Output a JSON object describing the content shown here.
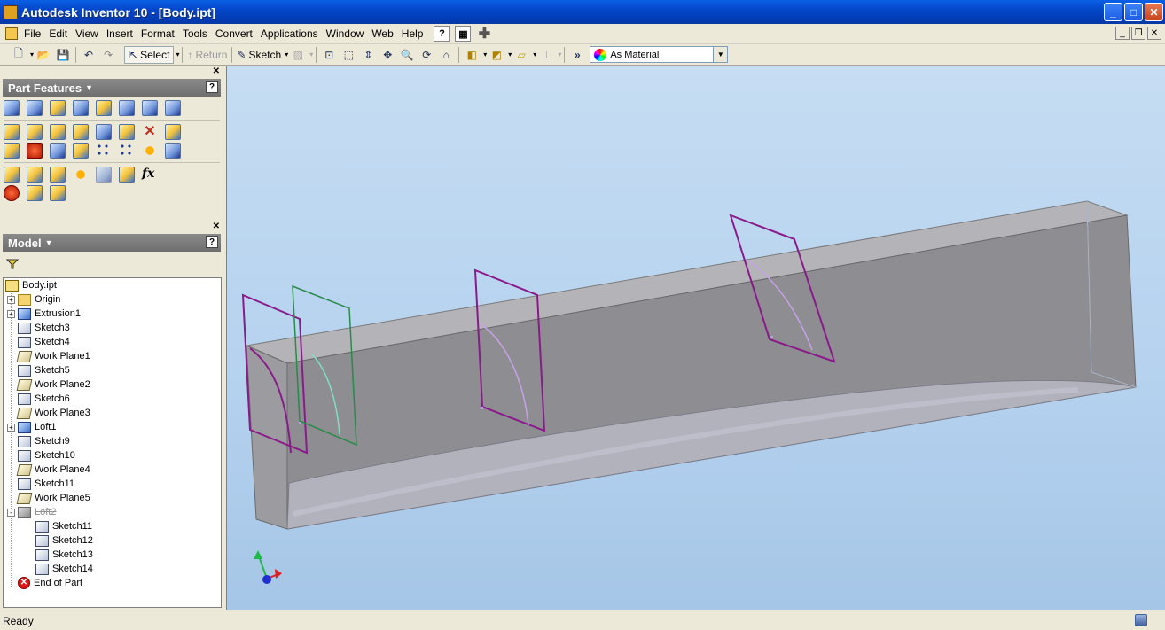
{
  "window": {
    "title": "Autodesk Inventor 10 - [Body.ipt]",
    "controls": [
      "minimize-icon",
      "maximize-icon",
      "close-icon"
    ]
  },
  "menu": {
    "items": [
      "File",
      "Edit",
      "View",
      "Insert",
      "Format",
      "Tools",
      "Convert",
      "Applications",
      "Window",
      "Web",
      "Help"
    ]
  },
  "toolbar": {
    "select_label": "Select",
    "return_label": "Return",
    "sketch_label": "Sketch",
    "color_select": "As Material"
  },
  "part_features": {
    "title": "Part Features",
    "help": "?"
  },
  "model": {
    "title": "Model",
    "help": "?",
    "tree": [
      {
        "label": "Body.ipt",
        "icon": "part-icon",
        "level": 0,
        "expander": ""
      },
      {
        "label": "Origin",
        "icon": "folder-icon",
        "level": 1,
        "expander": "+"
      },
      {
        "label": "Extrusion1",
        "icon": "extrusion-icon",
        "level": 1,
        "expander": "+"
      },
      {
        "label": "Sketch3",
        "icon": "sketch-icon",
        "level": 1,
        "expander": ""
      },
      {
        "label": "Sketch4",
        "icon": "sketch-icon",
        "level": 1,
        "expander": ""
      },
      {
        "label": "Work Plane1",
        "icon": "work-plane-icon",
        "level": 1,
        "expander": ""
      },
      {
        "label": "Sketch5",
        "icon": "sketch-icon",
        "level": 1,
        "expander": ""
      },
      {
        "label": "Work Plane2",
        "icon": "work-plane-icon",
        "level": 1,
        "expander": ""
      },
      {
        "label": "Sketch6",
        "icon": "sketch-icon",
        "level": 1,
        "expander": ""
      },
      {
        "label": "Work Plane3",
        "icon": "work-plane-icon",
        "level": 1,
        "expander": ""
      },
      {
        "label": "Loft1",
        "icon": "loft-icon",
        "level": 1,
        "expander": "+"
      },
      {
        "label": "Sketch9",
        "icon": "sketch-icon",
        "level": 1,
        "expander": ""
      },
      {
        "label": "Sketch10",
        "icon": "sketch-icon",
        "level": 1,
        "expander": ""
      },
      {
        "label": "Work Plane4",
        "icon": "work-plane-icon",
        "level": 1,
        "expander": ""
      },
      {
        "label": "Sketch11",
        "icon": "sketch-icon",
        "level": 1,
        "expander": ""
      },
      {
        "label": "Work Plane5",
        "icon": "work-plane-icon",
        "level": 1,
        "expander": ""
      },
      {
        "label": "Loft2",
        "icon": "loft-suppressed-icon",
        "level": 1,
        "expander": "-",
        "suppressed": true
      },
      {
        "label": "Sketch11",
        "icon": "sketch-icon",
        "level": 2,
        "expander": ""
      },
      {
        "label": "Sketch12",
        "icon": "sketch-icon",
        "level": 2,
        "expander": ""
      },
      {
        "label": "Sketch13",
        "icon": "sketch-icon",
        "level": 2,
        "expander": ""
      },
      {
        "label": "Sketch14",
        "icon": "sketch-icon",
        "level": 2,
        "expander": ""
      },
      {
        "label": "End of Part",
        "icon": "end-of-part-icon",
        "level": 1,
        "expander": ""
      }
    ]
  },
  "status": {
    "text": "Ready"
  },
  "colors": {
    "titlebar": "#0a5fe5",
    "viewport_bg": "#b4d1ee",
    "sketch_purple": "#8a1a8a",
    "sketch_green": "#2a8a4a",
    "body_gray": "#8f8f8f"
  }
}
